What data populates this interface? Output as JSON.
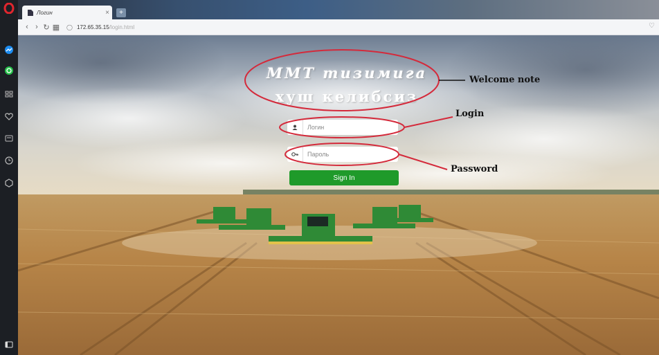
{
  "browser": {
    "tab_title": "Логин",
    "tab_close": "×",
    "url_host": "172.65.35.15",
    "url_path": "/login.html"
  },
  "sidebar": {
    "items": [
      "opera-logo",
      "messenger",
      "whatsapp",
      "speed-dial",
      "bookmarks",
      "snapshots",
      "history",
      "extensions",
      "sidebar-toggle"
    ]
  },
  "page": {
    "welcome_line1": "ММТ тизимига",
    "welcome_line2": "хуш келибсиз",
    "login_placeholder": "Логин",
    "password_placeholder": "Пароль",
    "sign_in_label": "Sign In"
  },
  "annotations": {
    "welcome": "Welcome note",
    "login": "Login",
    "password": "Password"
  },
  "colors": {
    "sign_in": "#1f9a2a",
    "annotation_ellipse": "#d42a3b",
    "sidebar_bg": "#1c1f24"
  }
}
